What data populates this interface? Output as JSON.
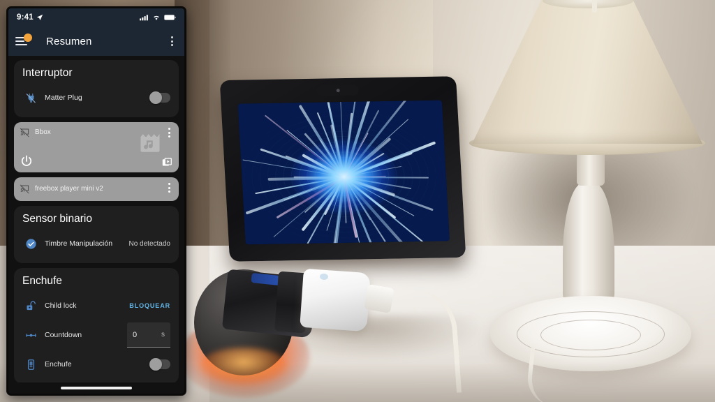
{
  "scene": {
    "description": "Bedside table with tablet smart display, beige table lamp, smart speaker and smart plug",
    "tablet_screensaver": "blue hyperspace tunnel"
  },
  "phone": {
    "status_bar": {
      "time": "9:41",
      "location_icon": "location-arrow-icon",
      "signal_icon": "cellular-signal-icon",
      "wifi_icon": "wifi-icon",
      "battery_icon": "battery-icon",
      "background_color": "#1c2733"
    },
    "app_bar": {
      "menu_icon": "hamburger-menu-icon",
      "notification_dot_color": "#f2a33c",
      "title": "Resumen",
      "overflow_icon": "overflow-menu-icon"
    },
    "cards": [
      {
        "type": "entity",
        "title": "Interruptor",
        "rows": [
          {
            "icon": "power-plug-off-icon",
            "label": "Matter Plug",
            "control": "toggle",
            "toggle_on": false
          }
        ]
      },
      {
        "type": "media",
        "name": "Bbox",
        "cast_icon": "cast-icon",
        "overflow_icon": "overflow-menu-icon",
        "power_icon": "power-icon",
        "watermark_icon": "movie-music-icon",
        "queue_icon": "media-library-icon",
        "background_color": "#9d9d9d"
      },
      {
        "type": "media",
        "name": "freebox player mini v2",
        "cast_icon": "cast-icon",
        "overflow_icon": "overflow-menu-icon",
        "background_color": "#9d9d9d"
      },
      {
        "type": "entity",
        "title": "Sensor binario",
        "rows": [
          {
            "icon": "check-circle-icon",
            "label": "Timbre Manipulación",
            "control": "value",
            "value": "No detectado"
          }
        ]
      },
      {
        "type": "entity",
        "title": "Enchufe",
        "rows": [
          {
            "icon": "lock-open-icon",
            "label": "Child lock",
            "control": "action",
            "action_label": "BLOQUEAR",
            "action_color": "#64b6e8"
          },
          {
            "icon": "timer-line-icon",
            "label": "Countdown",
            "control": "number",
            "value": "0",
            "unit": "s"
          },
          {
            "icon": "power-socket-icon",
            "label": "Enchufe",
            "control": "toggle",
            "toggle_on": false
          }
        ]
      }
    ],
    "home_indicator": "home-indicator-bar"
  }
}
